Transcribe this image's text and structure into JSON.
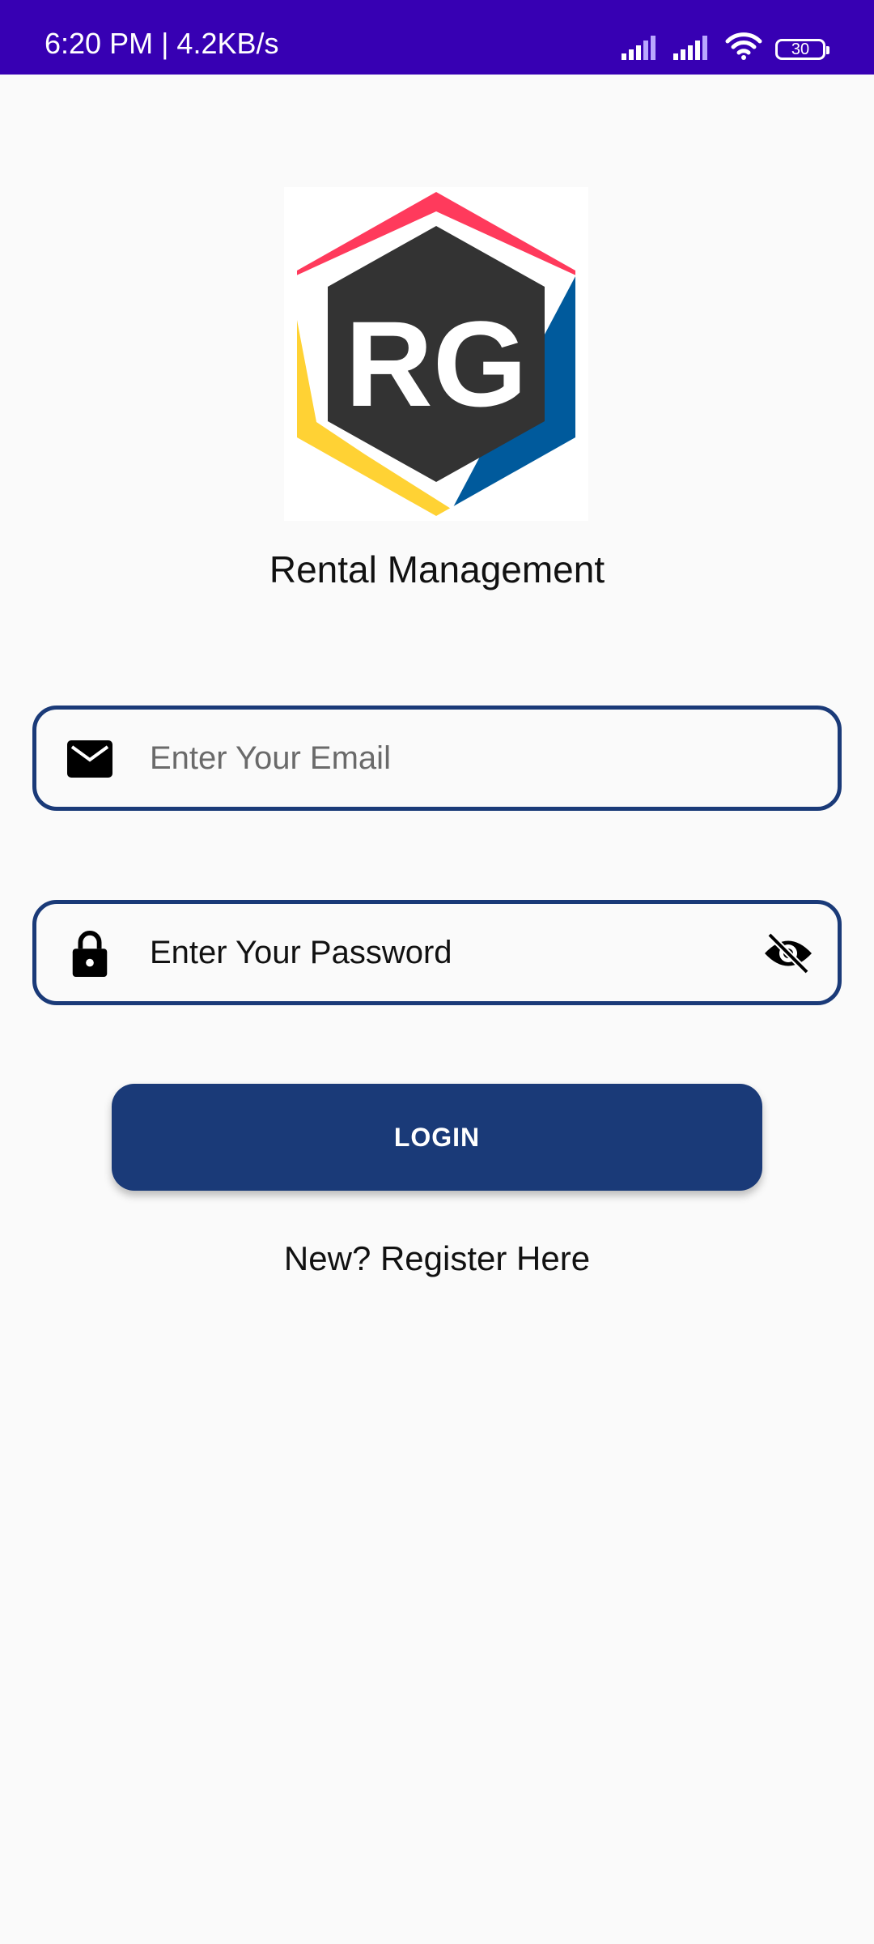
{
  "status_bar": {
    "time_speed": "6:20 PM | 4.2KB/s",
    "battery_level": "30",
    "icons": [
      "signal-icon",
      "signal-icon",
      "wifi-icon",
      "battery-icon"
    ]
  },
  "logo": {
    "text": "RG",
    "colors": [
      "#ff3a5c",
      "#005a9c",
      "#ffd234",
      "#333333"
    ]
  },
  "app_title": "Rental Management",
  "email_field": {
    "placeholder": "Enter Your Email",
    "icon": "mail-icon"
  },
  "password_field": {
    "placeholder": "Enter Your Password",
    "icon": "lock-icon",
    "toggle_icon": "eye-off-icon"
  },
  "login_button": "LOGIN",
  "register_link": "New? Register Here",
  "colors": {
    "status_bar": "#3700b3",
    "primary": "#1a3a78",
    "background": "#fafafa"
  }
}
